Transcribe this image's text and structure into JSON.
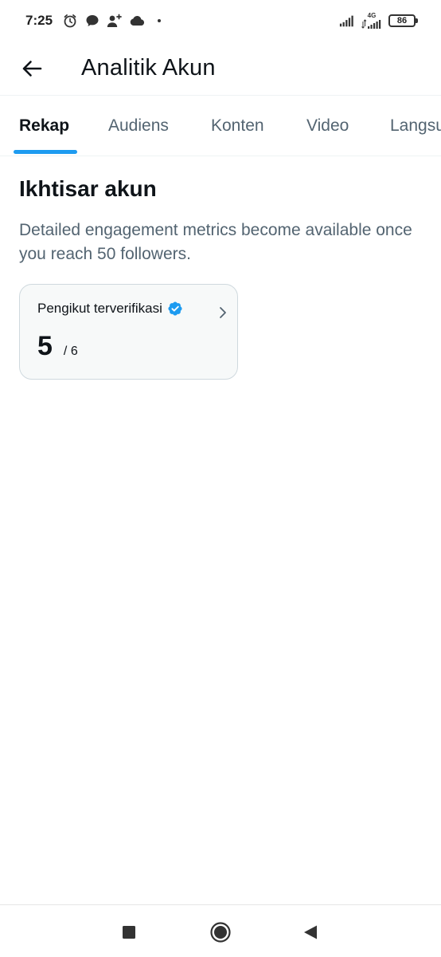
{
  "status_bar": {
    "time": "7:25",
    "network_label": "4G",
    "battery": "86",
    "icons": [
      "alarm-icon",
      "chat-bubble-icon",
      "person-add-icon",
      "cloud-icon",
      "dot-icon",
      "signal-icon",
      "signal-4g-icon",
      "battery-icon"
    ]
  },
  "header": {
    "title": "Analitik Akun",
    "back_icon": "arrow-left-icon"
  },
  "tabs": [
    {
      "label": "Rekap",
      "active": true
    },
    {
      "label": "Audiens",
      "active": false
    },
    {
      "label": "Konten",
      "active": false
    },
    {
      "label": "Video",
      "active": false
    },
    {
      "label": "Langsung",
      "active": false
    }
  ],
  "overview": {
    "title": "Ikhtisar akun",
    "description": "Detailed engagement metrics become available once you reach 50 followers."
  },
  "metric_card": {
    "label": "Pengikut terverifikasi",
    "value": "5",
    "total": "/ 6",
    "badge_color": "#1d9bf0"
  },
  "colors": {
    "accent": "#1d9bf0",
    "text_primary": "#0f1419",
    "text_secondary": "#536471"
  },
  "nav_bar": {
    "buttons": [
      "recents-square-icon",
      "home-circle-icon",
      "back-triangle-icon"
    ]
  }
}
